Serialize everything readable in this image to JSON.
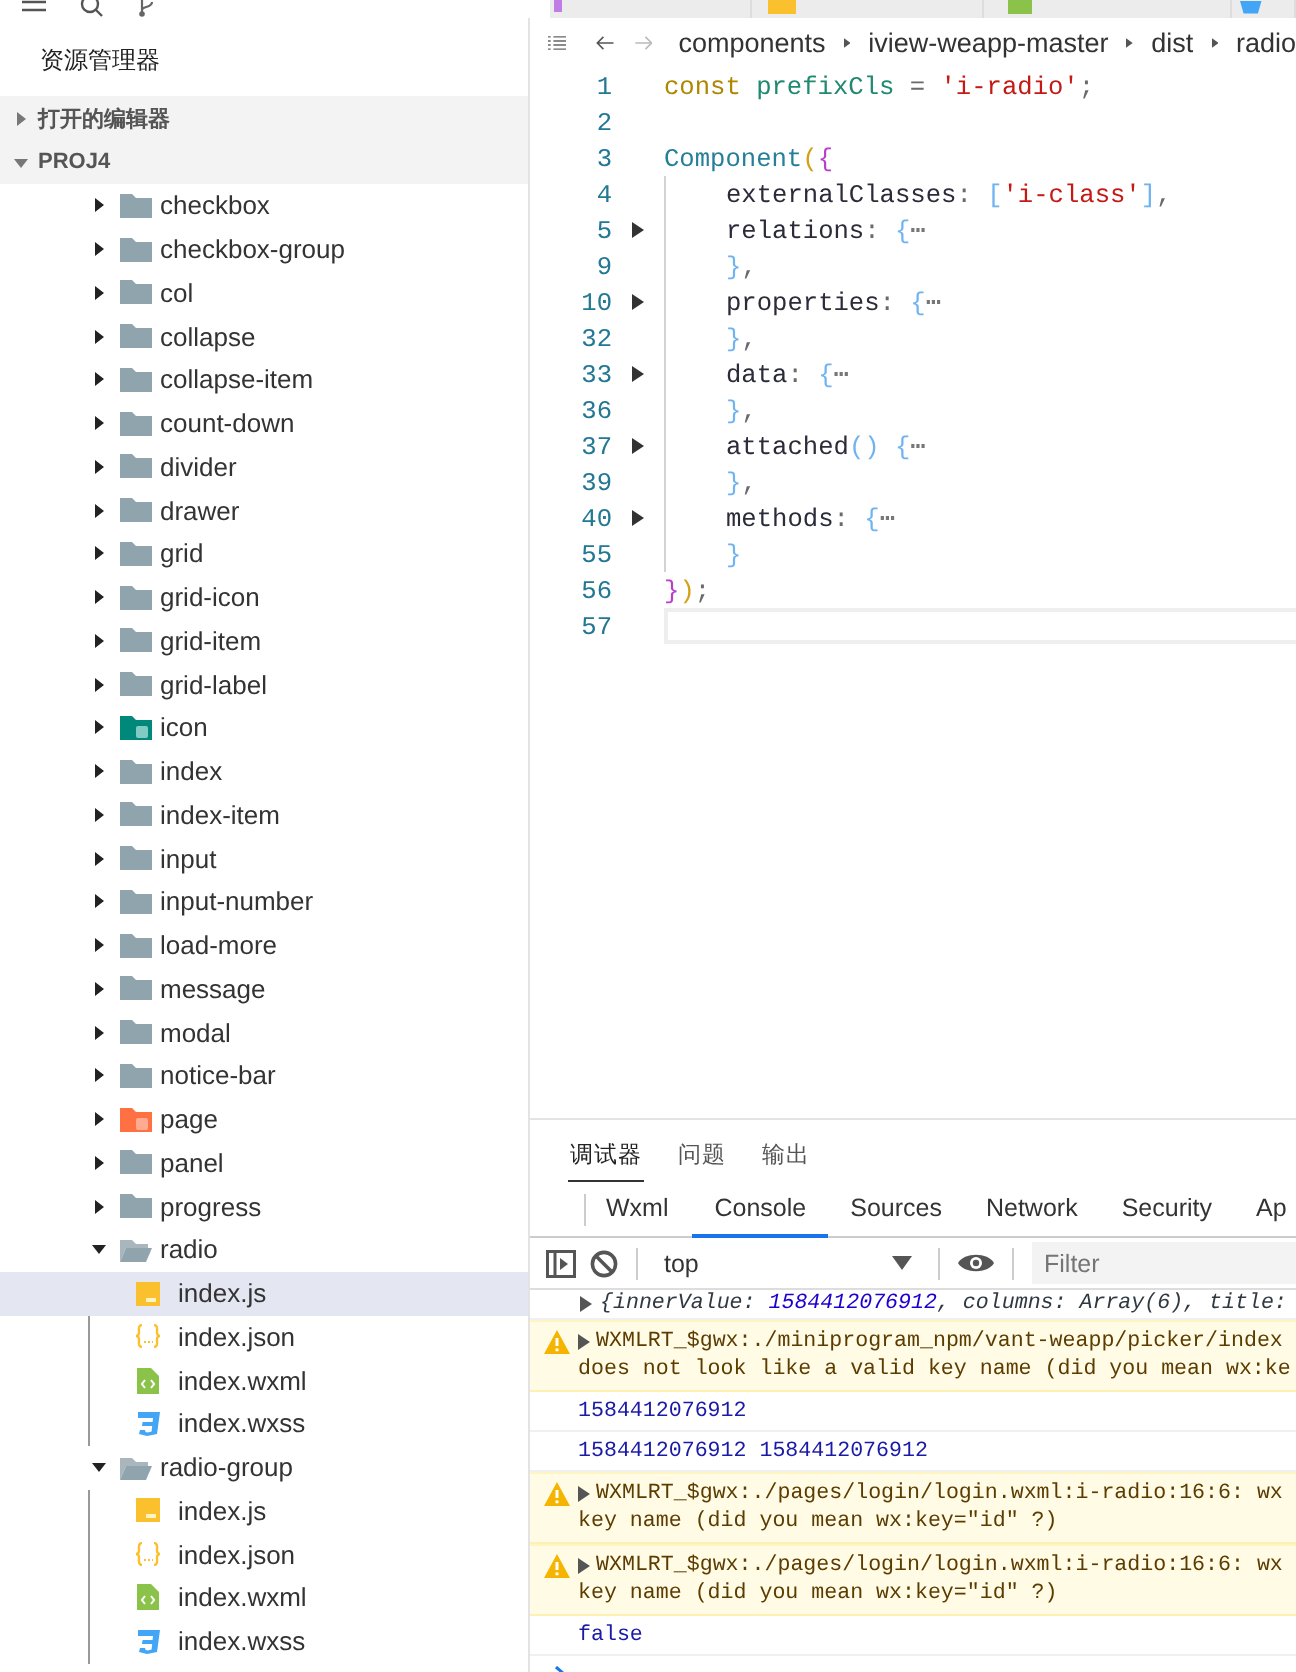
{
  "top_tabs": [
    {
      "kind": "json"
    },
    {
      "kind": "js"
    },
    {
      "kind": "wxml"
    },
    {
      "kind": "wxss"
    }
  ],
  "explorer": {
    "title": "资源管理器",
    "sections": [
      {
        "label": "打开的编辑器",
        "expanded": false
      },
      {
        "label": "PROJ4",
        "expanded": true
      }
    ],
    "tree": [
      {
        "label": "checkbox",
        "kind": "folder",
        "expanded": false
      },
      {
        "label": "checkbox-group",
        "kind": "folder",
        "expanded": false
      },
      {
        "label": "col",
        "kind": "folder",
        "expanded": false
      },
      {
        "label": "collapse",
        "kind": "folder",
        "expanded": false
      },
      {
        "label": "collapse-item",
        "kind": "folder",
        "expanded": false
      },
      {
        "label": "count-down",
        "kind": "folder",
        "expanded": false
      },
      {
        "label": "divider",
        "kind": "folder",
        "expanded": false
      },
      {
        "label": "drawer",
        "kind": "folder",
        "expanded": false
      },
      {
        "label": "grid",
        "kind": "folder",
        "expanded": false
      },
      {
        "label": "grid-icon",
        "kind": "folder",
        "expanded": false
      },
      {
        "label": "grid-item",
        "kind": "folder",
        "expanded": false
      },
      {
        "label": "grid-label",
        "kind": "folder",
        "expanded": false
      },
      {
        "label": "icon",
        "kind": "component-folder",
        "expanded": false
      },
      {
        "label": "index",
        "kind": "folder",
        "expanded": false
      },
      {
        "label": "index-item",
        "kind": "folder",
        "expanded": false
      },
      {
        "label": "input",
        "kind": "folder",
        "expanded": false
      },
      {
        "label": "input-number",
        "kind": "folder",
        "expanded": false
      },
      {
        "label": "load-more",
        "kind": "folder",
        "expanded": false
      },
      {
        "label": "message",
        "kind": "folder",
        "expanded": false
      },
      {
        "label": "modal",
        "kind": "folder",
        "expanded": false
      },
      {
        "label": "notice-bar",
        "kind": "folder",
        "expanded": false
      },
      {
        "label": "page",
        "kind": "page-folder",
        "expanded": false
      },
      {
        "label": "panel",
        "kind": "folder",
        "expanded": false
      },
      {
        "label": "progress",
        "kind": "folder",
        "expanded": false
      },
      {
        "label": "radio",
        "kind": "folder",
        "expanded": true,
        "children": [
          {
            "label": "index.js",
            "kind": "js",
            "selected": true
          },
          {
            "label": "index.json",
            "kind": "json",
            "selected": false
          },
          {
            "label": "index.wxml",
            "kind": "wxml",
            "selected": false
          },
          {
            "label": "index.wxss",
            "kind": "wxss",
            "selected": false
          }
        ]
      },
      {
        "label": "radio-group",
        "kind": "folder",
        "expanded": true,
        "children": [
          {
            "label": "index.js",
            "kind": "js",
            "selected": false
          },
          {
            "label": "index.json",
            "kind": "json",
            "selected": false
          },
          {
            "label": "index.wxml",
            "kind": "wxml",
            "selected": false
          },
          {
            "label": "index.wxss",
            "kind": "wxss",
            "selected": false
          }
        ]
      }
    ]
  },
  "editor": {
    "breadcrumb": [
      "components",
      "iview-weapp-master",
      "dist",
      "radio"
    ],
    "lines": [
      {
        "number": "1",
        "tokens": [
          {
            "kind": "keyword",
            "text": "const "
          },
          {
            "kind": "variable",
            "text": "prefixCls"
          },
          {
            "kind": "operator",
            "text": " = "
          },
          {
            "kind": "string",
            "text": "'i-radio'"
          },
          {
            "kind": "operator",
            "text": ";"
          }
        ]
      },
      {
        "number": "2"
      },
      {
        "number": "3",
        "tokens": [
          {
            "kind": "type",
            "text": "Component"
          },
          {
            "kind": "paren",
            "text": "("
          },
          {
            "kind": "brace",
            "text": "{"
          }
        ]
      },
      {
        "number": "4",
        "indented": true,
        "tokens": [
          {
            "kind": "property",
            "text": "externalClasses"
          },
          {
            "kind": "operator",
            "text": ": "
          },
          {
            "kind": "bracket",
            "text": "["
          },
          {
            "kind": "string",
            "text": "'i-class'"
          },
          {
            "kind": "bracket",
            "text": "]"
          },
          {
            "kind": "operator",
            "text": ","
          }
        ]
      },
      {
        "number": "5",
        "indented": true,
        "foldable": true,
        "tokens": [
          {
            "kind": "property",
            "text": "relations"
          },
          {
            "kind": "operator",
            "text": ": "
          },
          {
            "kind": "bracket",
            "text": "{"
          },
          {
            "kind": "fold",
            "text": "⋯"
          }
        ]
      },
      {
        "number": "9",
        "indented": true,
        "tokens": [
          {
            "kind": "bracket",
            "text": "}"
          },
          {
            "kind": "operator",
            "text": ","
          }
        ]
      },
      {
        "number": "10",
        "indented": true,
        "foldable": true,
        "tokens": [
          {
            "kind": "property",
            "text": "properties"
          },
          {
            "kind": "operator",
            "text": ": "
          },
          {
            "kind": "bracket",
            "text": "{"
          },
          {
            "kind": "fold",
            "text": "⋯"
          }
        ]
      },
      {
        "number": "32",
        "indented": true,
        "tokens": [
          {
            "kind": "bracket",
            "text": "}"
          },
          {
            "kind": "operator",
            "text": ","
          }
        ]
      },
      {
        "number": "33",
        "indented": true,
        "foldable": true,
        "tokens": [
          {
            "kind": "property",
            "text": "data"
          },
          {
            "kind": "operator",
            "text": ": "
          },
          {
            "kind": "bracket",
            "text": "{"
          },
          {
            "kind": "fold",
            "text": "⋯"
          }
        ]
      },
      {
        "number": "36",
        "indented": true,
        "tokens": [
          {
            "kind": "bracket",
            "text": "}"
          },
          {
            "kind": "operator",
            "text": ","
          }
        ]
      },
      {
        "number": "37",
        "indented": true,
        "foldable": true,
        "tokens": [
          {
            "kind": "property",
            "text": "attached"
          },
          {
            "kind": "bracket",
            "text": "() {"
          },
          {
            "kind": "fold",
            "text": "⋯"
          }
        ]
      },
      {
        "number": "39",
        "indented": true,
        "tokens": [
          {
            "kind": "bracket",
            "text": "}"
          },
          {
            "kind": "operator",
            "text": ","
          }
        ]
      },
      {
        "number": "40",
        "indented": true,
        "foldable": true,
        "tokens": [
          {
            "kind": "property",
            "text": "methods"
          },
          {
            "kind": "operator",
            "text": ": "
          },
          {
            "kind": "bracket",
            "text": "{"
          },
          {
            "kind": "fold",
            "text": "⋯"
          }
        ]
      },
      {
        "number": "55",
        "indented": true,
        "tokens": [
          {
            "kind": "bracket",
            "text": "}"
          }
        ]
      },
      {
        "number": "56",
        "tokens": [
          {
            "kind": "brace",
            "text": "}"
          },
          {
            "kind": "paren",
            "text": ")"
          },
          {
            "kind": "operator",
            "text": ";"
          }
        ]
      },
      {
        "number": "57",
        "current": true
      }
    ]
  },
  "bottom_panel": {
    "tabs": [
      {
        "label": "调试器",
        "selected": true
      },
      {
        "label": "问题",
        "selected": false
      },
      {
        "label": "输出",
        "selected": false
      }
    ],
    "devtools_tabs": [
      {
        "label": "Wxml",
        "selected": false
      },
      {
        "label": "Console",
        "selected": true
      },
      {
        "label": "Sources",
        "selected": false
      },
      {
        "label": "Network",
        "selected": false
      },
      {
        "label": "Security",
        "selected": false
      },
      {
        "label": "Ap",
        "selected": false
      }
    ],
    "toolbar": {
      "context": "top",
      "filter_placeholder": "Filter"
    },
    "messages": [
      {
        "kind": "object",
        "tokens": [
          {
            "kind": "plain",
            "text": "{innerValue: "
          },
          {
            "kind": "number",
            "text": "1584412076912"
          },
          {
            "kind": "plain",
            "text": ", columns: Array(6), title:"
          }
        ]
      },
      {
        "kind": "warning",
        "lines": [
          "WXMLRT_$gwx:./miniprogram_npm/vant-weapp/picker/index",
          "does not look like a valid key name (did you mean wx:ke"
        ]
      },
      {
        "kind": "log",
        "lines": [
          "1584412076912"
        ]
      },
      {
        "kind": "log",
        "lines": [
          "1584412076912 1584412076912"
        ]
      },
      {
        "kind": "warning",
        "lines": [
          "WXMLRT_$gwx:./pages/login/login.wxml:i-radio:16:6: wx",
          "key name (did you mean wx:key=\"id\" ?)"
        ]
      },
      {
        "kind": "warning",
        "lines": [
          "WXMLRT_$gwx:./pages/login/login.wxml:i-radio:16:6: wx",
          "key name (did you mean wx:key=\"id\" ?)"
        ]
      },
      {
        "kind": "log",
        "lines": [
          "false"
        ]
      }
    ]
  }
}
